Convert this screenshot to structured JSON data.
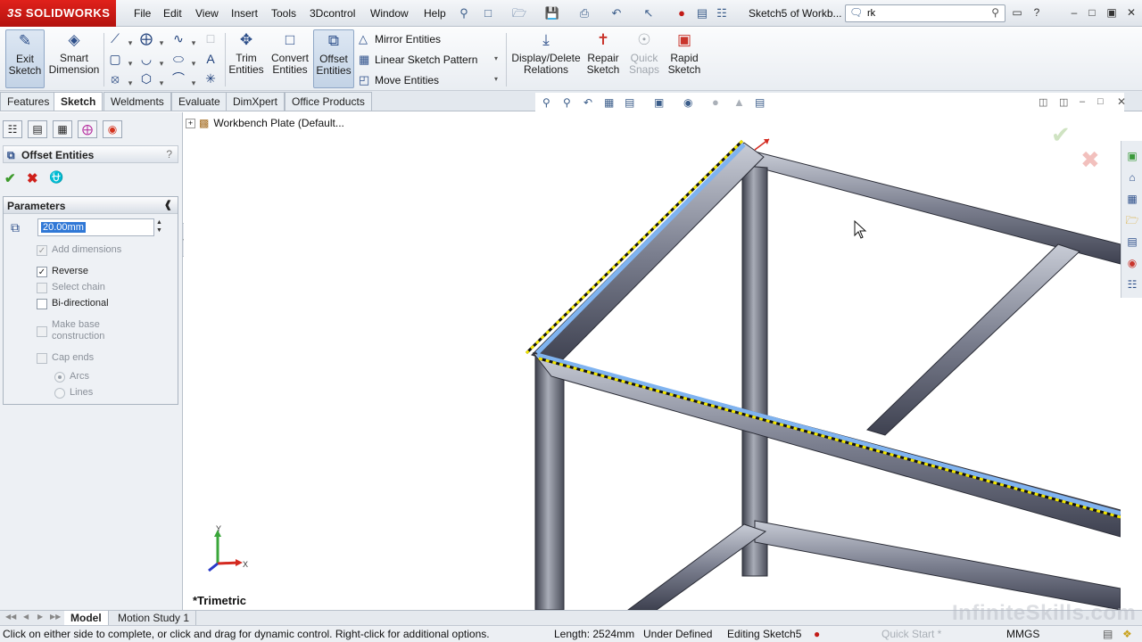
{
  "app": {
    "logo_prefix": "3S",
    "logo_text": "SOLIDWORKS"
  },
  "menu": [
    "File",
    "Edit",
    "View",
    "Insert",
    "Tools",
    "3Dcontrol",
    "Window",
    "Help"
  ],
  "document_title": "Sketch5 of Workb...",
  "search": {
    "value": "rk"
  },
  "ribbon": {
    "exit_sketch": "Exit\nSketch",
    "smart_dimension": "Smart\nDimension",
    "trim_entities": "Trim\nEntities",
    "convert_entities": "Convert\nEntities",
    "offset_entities": "Offset\nEntities",
    "mirror_entities": "Mirror Entities",
    "linear_pattern": "Linear Sketch Pattern",
    "move_entities": "Move Entities",
    "display_delete_relations": "Display/Delete\nRelations",
    "repair_sketch": "Repair\nSketch",
    "quick_snaps": "Quick\nSnaps",
    "rapid_sketch": "Rapid\nSketch"
  },
  "tabs": [
    "Features",
    "Sketch",
    "Weldments",
    "Evaluate",
    "DimXpert",
    "Office Products"
  ],
  "active_tab": "Sketch",
  "property_manager": {
    "title": "Offset Entities",
    "help": "?",
    "group_title": "Parameters",
    "distance": "20.00mm",
    "options": [
      {
        "label": "Add dimensions",
        "checked": true,
        "disabled": true
      },
      {
        "label": "Reverse",
        "checked": true,
        "disabled": false
      },
      {
        "label": "Select chain",
        "checked": false,
        "disabled": true
      },
      {
        "label": "Bi-directional",
        "checked": false,
        "disabled": false
      },
      {
        "label": "Make base\nconstruction",
        "checked": false,
        "disabled": true
      },
      {
        "label": "Cap ends",
        "checked": false,
        "disabled": true
      }
    ],
    "cap_types": [
      {
        "label": "Arcs",
        "selected": true
      },
      {
        "label": "Lines",
        "selected": false
      }
    ]
  },
  "viewport": {
    "tree_root": "Workbench Plate  (Default...",
    "view_name": "*Trimetric",
    "triad": {
      "x": "X",
      "y": "Y"
    }
  },
  "bottom_tabs": [
    "Model",
    "Motion Study 1"
  ],
  "status": {
    "message": "Click on either side to complete, or click and drag for dynamic control.  Right-click for additional options.",
    "length": "Length: 2524mm",
    "state": "Under Defined",
    "editing": "Editing Sketch5",
    "quick_start": "Quick Start *",
    "units": "MMGS"
  },
  "watermark": "InfiniteSkills.com",
  "colors": {
    "accent": "#2d4f8a",
    "logo_red": "#d11a14",
    "selection": "#3078d6",
    "highlight_edge": "#7fb3f0"
  }
}
